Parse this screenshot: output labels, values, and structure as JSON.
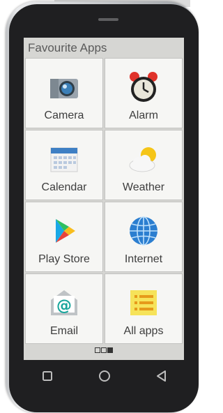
{
  "screen": {
    "title": "Favourite Apps",
    "tiles": [
      {
        "label": "Camera",
        "icon": "camera-icon"
      },
      {
        "label": "Alarm",
        "icon": "alarm-clock-icon"
      },
      {
        "label": "Calendar",
        "icon": "calendar-icon"
      },
      {
        "label": "Weather",
        "icon": "weather-icon"
      },
      {
        "label": "Play Store",
        "icon": "play-store-icon"
      },
      {
        "label": "Internet",
        "icon": "globe-icon"
      },
      {
        "label": "Email",
        "icon": "email-icon"
      },
      {
        "label": "All apps",
        "icon": "list-icon"
      }
    ],
    "pager": {
      "pages": 3,
      "active_page": 3
    }
  },
  "nav": {
    "recents_icon": "square-icon",
    "home_icon": "circle-icon",
    "back_icon": "triangle-back-icon"
  },
  "colors": {
    "phone_body": "#1f1f21",
    "screen_bg": "#d6d6d3",
    "tile_bg": "#f6f6f4"
  }
}
